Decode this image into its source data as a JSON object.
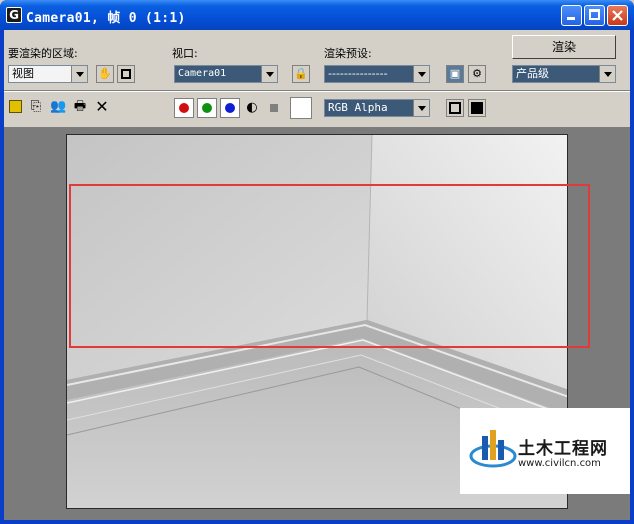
{
  "window": {
    "title": "Camera01, 帧 0 (1:1)",
    "icon": "3dsmax-app-icon"
  },
  "controls": {
    "area_label": "要渲染的区域:",
    "area_value": "视图",
    "viewport_label": "视口:",
    "viewport_value": "Camera01",
    "preset_label": "渲染预设:",
    "preset_value": "---------------",
    "render_button": "渲染",
    "quality_value": "产品级",
    "channel_value": "RGB Alpha"
  },
  "toolbar": {
    "icons": [
      "save-icon",
      "copy-icon",
      "clone-icon",
      "print-icon",
      "clear-icon"
    ],
    "channels": [
      {
        "name": "red-channel",
        "color": "#d01010"
      },
      {
        "name": "green-channel",
        "color": "#109010"
      },
      {
        "name": "blue-channel",
        "color": "#1020d0"
      }
    ]
  },
  "watermark": {
    "site_name": "土木工程网",
    "url": "www.civilcn.com"
  },
  "colors": {
    "title_bar": "#0550d8",
    "highlight_box": "#e03a3a",
    "dropdown_bg": "#3c5a78"
  }
}
